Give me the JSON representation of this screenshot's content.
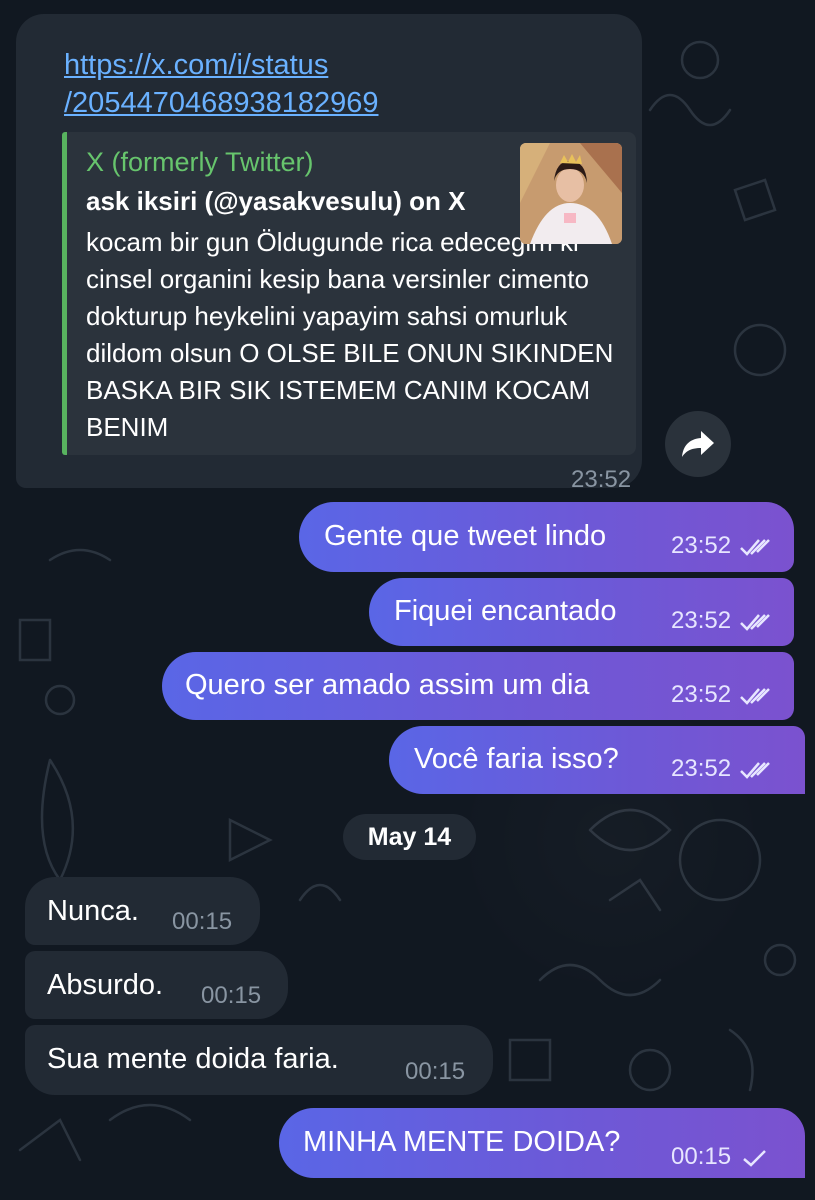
{
  "link_message": {
    "url_line1": "https://x.com/i/status",
    "url_line2": "/2054470468938182969",
    "preview": {
      "site_name": "X (formerly Twitter)",
      "title": "ask iksiri (@yasakvesulu) on X",
      "body": "kocam bir gun Öldugunde rica edecegim ki cinsel organini kesip bana versinler cimento dokturup heykelini yapayim sahsi omurluk dildom olsun O OLSE BILE ONUN SIKINDEN BASKA BIR SIK ISTEMEM CANIM KOCAM BENIM"
    },
    "time": "23:52"
  },
  "outgoing_messages": [
    {
      "text": "Gente que tweet lindo",
      "time": "23:52",
      "status": "read"
    },
    {
      "text": "Fiquei encantado",
      "time": "23:52",
      "status": "read"
    },
    {
      "text": "Quero ser amado assim um dia",
      "time": "23:52",
      "status": "read"
    },
    {
      "text": "Você faria isso?",
      "time": "23:52",
      "status": "read"
    }
  ],
  "date_separator": "May 14",
  "incoming_messages": [
    {
      "text": "Nunca.",
      "time": "00:15"
    },
    {
      "text": "Absurdo.",
      "time": "00:15"
    },
    {
      "text": "Sua mente doida faria.",
      "time": "00:15"
    }
  ],
  "last_outgoing": {
    "text": "MINHA MENTE DOIDA?",
    "time": "00:15",
    "status": "sent"
  },
  "icons": {
    "share": "forward-arrow-icon",
    "read": "double-check-icon",
    "sent": "single-check-icon"
  },
  "colors": {
    "background": "#111821",
    "incoming_bubble": "#222a34",
    "outgoing_bubble": "#5a66e6",
    "link": "#6ab1ff",
    "preview_accent": "#58b35f"
  }
}
